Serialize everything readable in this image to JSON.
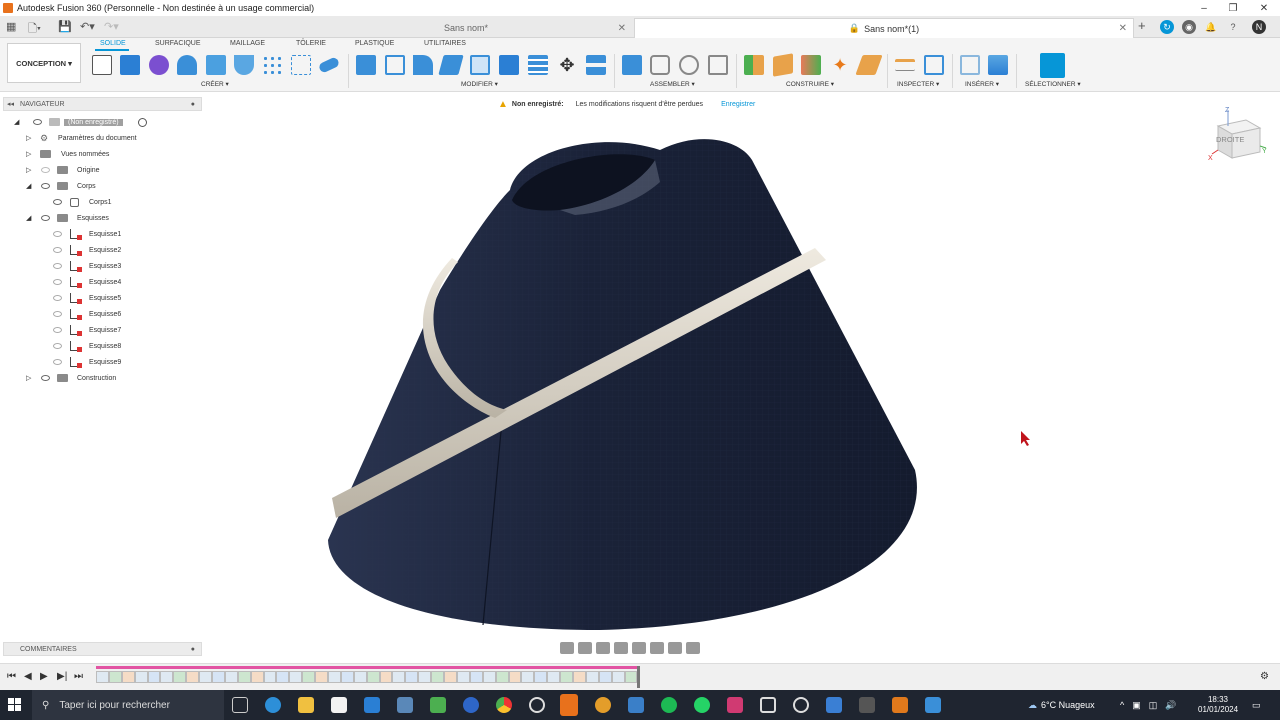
{
  "window": {
    "title": "Autodesk Fusion 360 (Personnelle - Non destinée à un usage commercial)"
  },
  "tabs": [
    {
      "label": "Sans nom*",
      "active": false
    },
    {
      "label": "Sans nom*(1)",
      "active": true
    }
  ],
  "workspace": {
    "label": "CONCEPTION ▾"
  },
  "ribbon_tabs": [
    "SOLIDE",
    "SURFACIQUE",
    "MAILLAGE",
    "TÔLERIE",
    "PLASTIQUE",
    "UTILITAIRES"
  ],
  "tool_groups": {
    "create": "CRÉER ▾",
    "modify": "MODIFIER ▾",
    "assemble": "ASSEMBLER ▾",
    "construct": "CONSTRUIRE ▾",
    "inspect": "INSPECTER ▾",
    "insert": "INSÉRER ▾",
    "select": "SÉLECTIONNER ▾"
  },
  "navigator": {
    "title": "NAVIGATEUR",
    "root": "(Non enregistré)",
    "items": {
      "doc_params": "Paramètres du document",
      "named_views": "Vues nommées",
      "origin": "Origine",
      "bodies": "Corps",
      "body1": "Corps1",
      "sketches": "Esquisses",
      "construction": "Construction"
    },
    "sketches": [
      "Esquisse1",
      "Esquisse2",
      "Esquisse3",
      "Esquisse4",
      "Esquisse5",
      "Esquisse6",
      "Esquisse7",
      "Esquisse8",
      "Esquisse9"
    ]
  },
  "notice": {
    "title": "Non enregistré:",
    "message": "Les modifications risquent d'être perdues",
    "action": "Enregistrer"
  },
  "viewcube": {
    "face": "DROITE",
    "axis_z": "Z",
    "axis_y": "Y",
    "axis_x": "X"
  },
  "comments": {
    "title": "COMMENTAIRES"
  },
  "taskbar": {
    "search_placeholder": "Taper ici pour rechercher",
    "weather": "6°C  Nuageux",
    "time": "18:33",
    "date": "01/01/2024"
  },
  "colors": {
    "accent": "#0696d7",
    "body": "#1b2540",
    "stripe": "#d6d0c4",
    "timeline_bar": "#e254a3"
  }
}
